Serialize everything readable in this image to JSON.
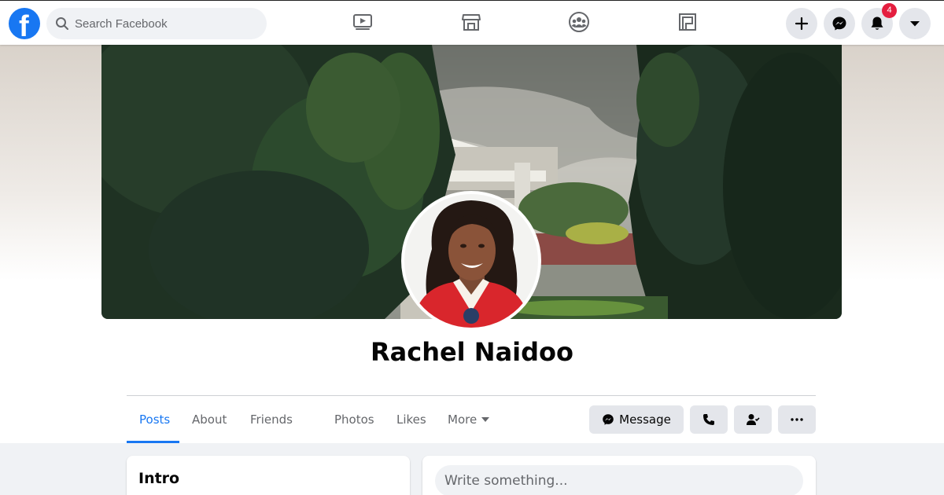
{
  "topbar": {
    "logo_letter": "f",
    "search_placeholder": "Search Facebook",
    "nav_icons": [
      "watch-icon",
      "marketplace-icon",
      "groups-icon",
      "gaming-icon"
    ],
    "right_buttons": [
      "create-icon",
      "messenger-icon",
      "notifications-icon",
      "account-menu-icon"
    ],
    "notification_count": "4"
  },
  "profile": {
    "name": "Rachel Naidoo",
    "tabs": [
      {
        "label": "Posts"
      },
      {
        "label": "About"
      },
      {
        "label": "Friends"
      },
      {
        "label": "Photos"
      },
      {
        "label": "Likes"
      },
      {
        "label": "More"
      }
    ],
    "active_tab": "Posts",
    "actions": {
      "message_label": "Message"
    }
  },
  "intro": {
    "title": "Intro"
  },
  "composer": {
    "placeholder": "Write something..."
  },
  "colors": {
    "brand": "#1877f2",
    "badge": "#e41e3f",
    "button_bg": "#e4e6eb",
    "page_bg": "#f0f2f5"
  }
}
